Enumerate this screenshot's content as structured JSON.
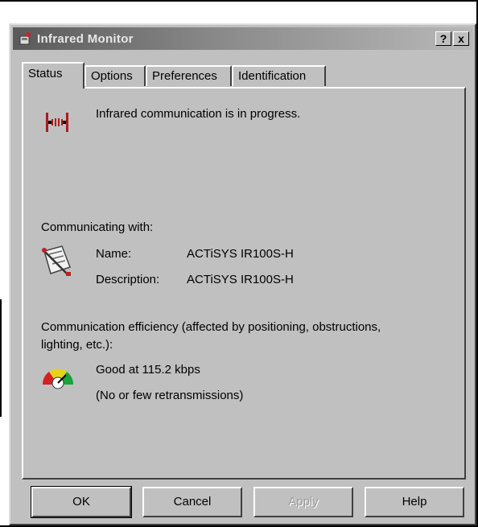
{
  "window": {
    "title": "Infrared Monitor",
    "help_glyph": "?",
    "close_glyph": "x"
  },
  "tabs": [
    {
      "label": "Status"
    },
    {
      "label": "Options"
    },
    {
      "label": "Preferences"
    },
    {
      "label": "Identification"
    }
  ],
  "status": {
    "message": "Infrared communication is in progress.",
    "communicating_with_label": "Communicating with:",
    "name_label": "Name:",
    "name_value": "ACTiSYS IR100S-H",
    "description_label": "Description:",
    "description_value": "ACTiSYS IR100S-H",
    "efficiency_label_line1": "Communication efficiency (affected by positioning, obstructions,",
    "efficiency_label_line2": "lighting, etc.):",
    "efficiency_value": "Good at 115.2 kbps",
    "retransmissions": "(No or few retransmissions)"
  },
  "buttons": {
    "ok": "OK",
    "cancel": "Cancel",
    "apply": "Apply",
    "help": "Help"
  },
  "icons": {
    "title": "infrared-monitor-icon",
    "status": "infrared-beam-icon",
    "device": "device-icon",
    "efficiency": "gauge-icon"
  }
}
